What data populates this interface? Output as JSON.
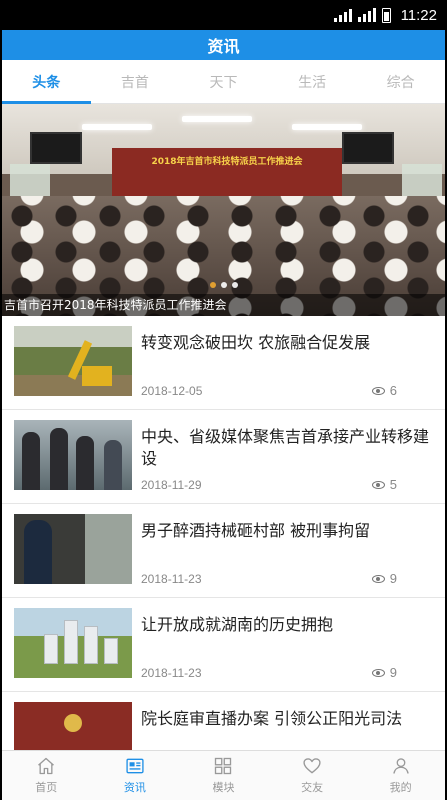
{
  "status_bar": {
    "time": "11:22"
  },
  "header": {
    "title": "资讯"
  },
  "tabs": [
    {
      "label": "头条",
      "active": true
    },
    {
      "label": "吉首",
      "active": false
    },
    {
      "label": "天下",
      "active": false
    },
    {
      "label": "生活",
      "active": false
    },
    {
      "label": "综合",
      "active": false
    }
  ],
  "banner": {
    "caption": "吉首市召开2018年科技特派员工作推进会",
    "slide_text": "2018年吉首市科技特派员工作推进会",
    "slide_count": 3,
    "active_slide": 1
  },
  "news": [
    {
      "title": "转变观念破田坎 农旅融合促发展",
      "date": "2018-12-05",
      "views": "6"
    },
    {
      "title": "中央、省级媒体聚焦吉首承接产业转移建设",
      "date": "2018-11-29",
      "views": "5"
    },
    {
      "title": "男子醉酒持械砸村部 被刑事拘留",
      "date": "2018-11-23",
      "views": "9"
    },
    {
      "title": "让开放成就湖南的历史拥抱",
      "date": "2018-11-23",
      "views": "9"
    },
    {
      "title": "院长庭审直播办案 引领公正阳光司法",
      "date": "",
      "views": ""
    }
  ],
  "bottom_nav": [
    {
      "label": "首页",
      "icon": "home-icon",
      "active": false
    },
    {
      "label": "资讯",
      "icon": "news-icon",
      "active": true
    },
    {
      "label": "模块",
      "icon": "grid-icon",
      "active": false
    },
    {
      "label": "交友",
      "icon": "heart-icon",
      "active": false
    },
    {
      "label": "我的",
      "icon": "person-icon",
      "active": false
    }
  ],
  "colors": {
    "accent": "#1e8fe6",
    "inactive": "#b9b9b9"
  }
}
